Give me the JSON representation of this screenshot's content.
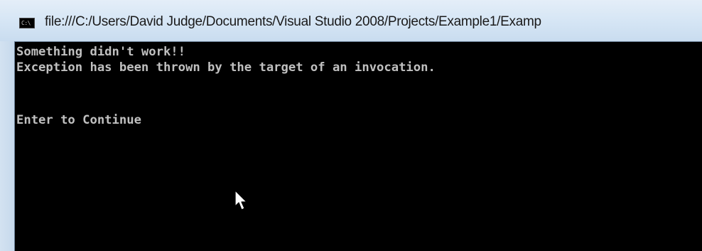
{
  "window": {
    "title": "file:///C:/Users/David Judge/Documents/Visual Studio 2008/Projects/Example1/Examp",
    "icon": "console-window-icon",
    "icon_glyph": "C:\\"
  },
  "console": {
    "lines": [
      "Something didn't work!!",
      "Exception has been thrown by the target of an invocation.",
      "",
      "Enter to Continue"
    ],
    "background_color": "#000000",
    "text_color": "#c0c0c0"
  },
  "cursor": {
    "icon": "mouse-pointer-icon"
  }
}
